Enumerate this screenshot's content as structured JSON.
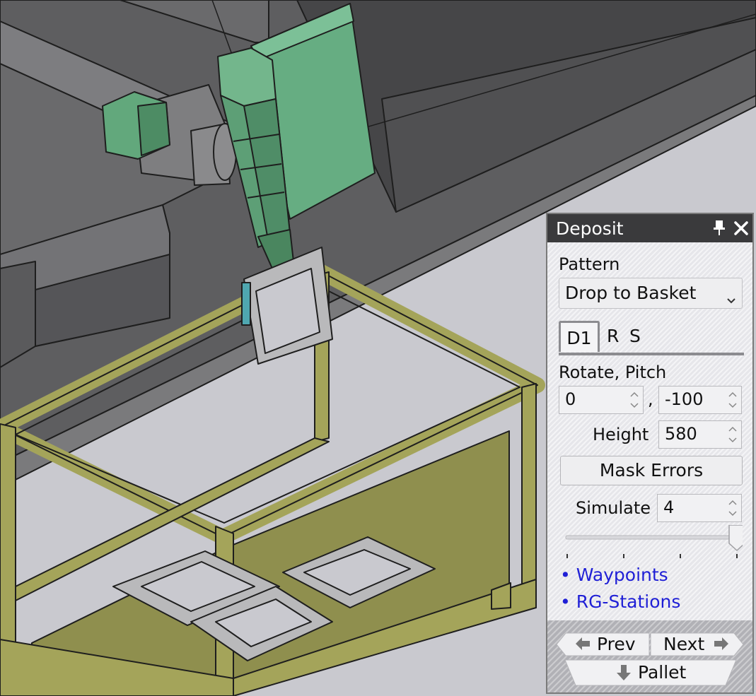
{
  "panel": {
    "title": "Deposit",
    "pattern_label": "Pattern",
    "pattern_value": "Drop to Basket",
    "tabs": [
      "D1",
      "R",
      "S"
    ],
    "rotate_pitch_label": "Rotate, Pitch",
    "rotate_value": "0",
    "separator": ",",
    "pitch_value": "-100",
    "height_label": "Height",
    "height_value": "580",
    "mask_errors_label": "Mask Errors",
    "simulate_label": "Simulate",
    "simulate_value": "4",
    "slider_fraction": 1.0,
    "links": [
      "• Waypoints",
      "• RG-Stations"
    ],
    "nav": {
      "prev": "Prev",
      "next": "Next",
      "pallet": "Pallet"
    }
  },
  "icons": {
    "pin": "pin-icon",
    "close": "close-icon",
    "chevron": "chevron-down-icon",
    "prev": "arrow-left-icon",
    "next": "arrow-right-icon",
    "pallet": "arrow-down-icon"
  },
  "colors": {
    "background": "#c9c9cf",
    "machine": "#6e6e70",
    "gripper": "#62a87c",
    "basket_frame": "#a4a45a",
    "basket_floor": "#8f8f4e",
    "link": "#1f1fd6",
    "titlebar": "#3a3a3c"
  }
}
